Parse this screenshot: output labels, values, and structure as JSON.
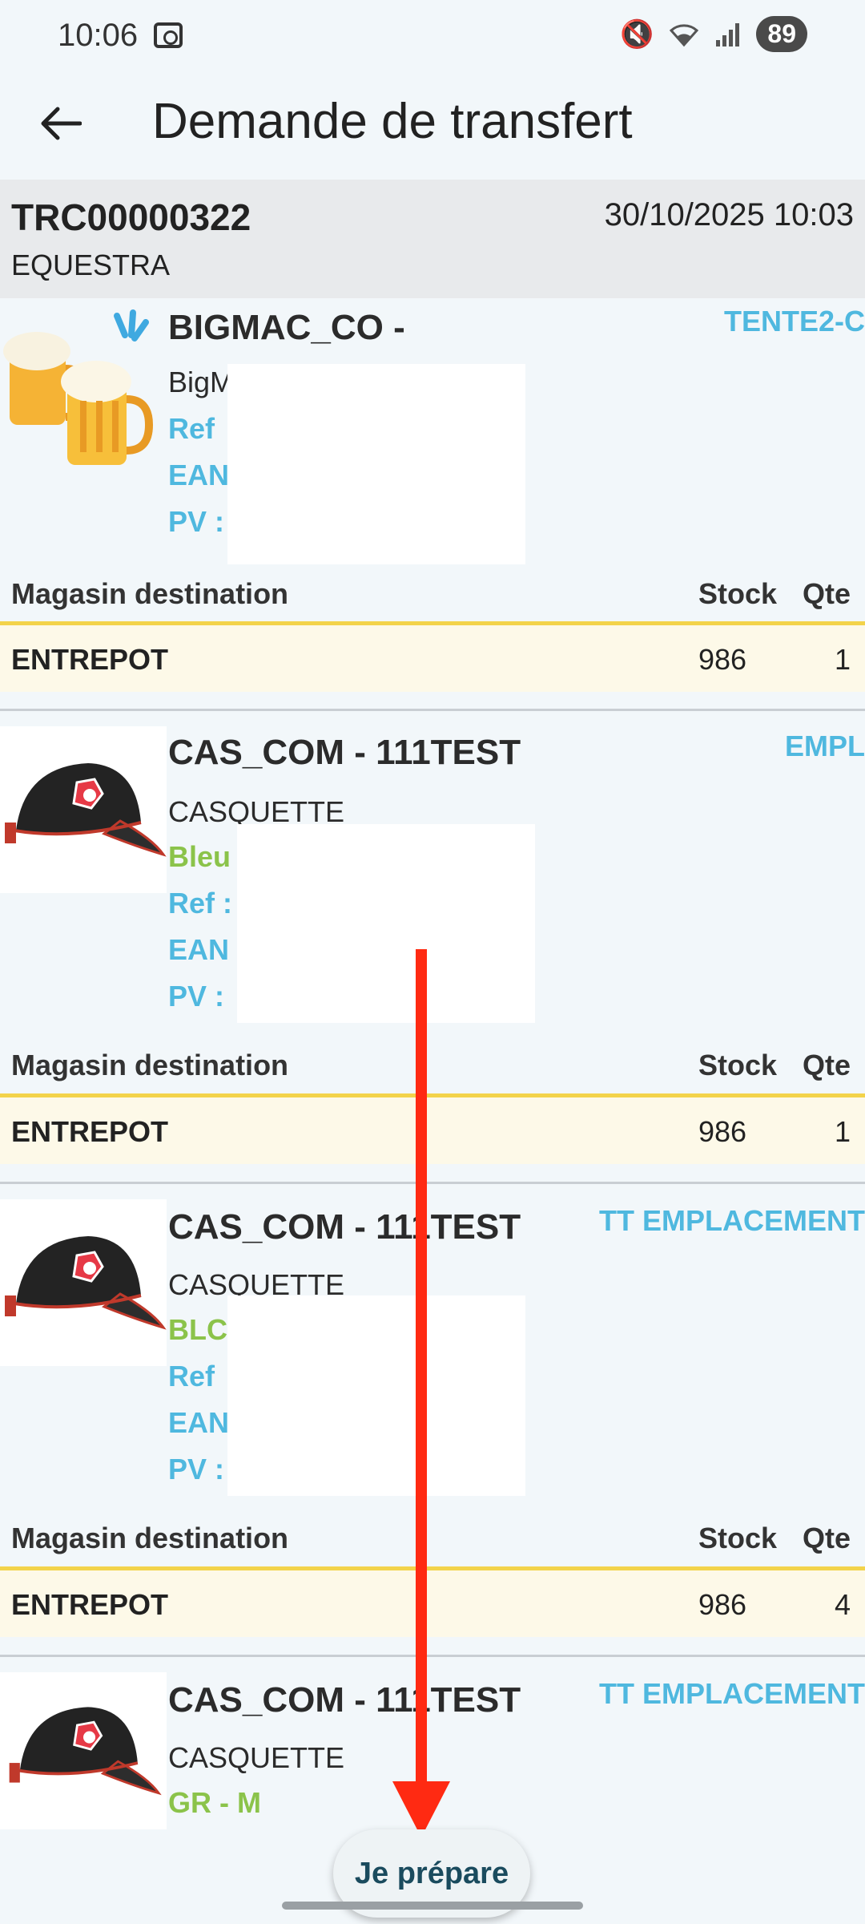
{
  "status_bar": {
    "time": "10:06",
    "battery": "89",
    "icons": [
      "screen-record-icon",
      "mute-icon",
      "wifi-icon",
      "signal-icon"
    ]
  },
  "app_bar": {
    "title": "Demande de transfert"
  },
  "order": {
    "id": "TRC00000322",
    "date": "30/10/2025 10:03",
    "client": "EQUESTRA"
  },
  "labels": {
    "destination_header": "Magasin destination",
    "stock_header": "Stock",
    "qty_header": "Qte"
  },
  "products": [
    {
      "title": "BIGMAC_CO -",
      "location": "TENTE2-C",
      "subtitle": "BigM",
      "variant": "",
      "ref": "Ref",
      "ean": "EAN",
      "pv": "PV :",
      "image": "beer-icon",
      "destination": "ENTREPOT",
      "stock": "986",
      "qty": "1"
    },
    {
      "title": "CAS_COM - 111TEST",
      "location": "EMPL",
      "subtitle": "CASQUETTE",
      "variant": "Bleu",
      "ref": "Ref :",
      "ean": "EAN",
      "pv": "PV :",
      "image": "cap-image",
      "destination": "ENTREPOT",
      "stock": "986",
      "qty": "1"
    },
    {
      "title": "CAS_COM - 111TEST",
      "location": "TT EMPLACEMENT",
      "subtitle": "CASQUETTE",
      "variant": "BLC",
      "ref": "Ref",
      "ean": "EAN",
      "pv": "PV :",
      "image": "cap-image",
      "destination": "ENTREPOT",
      "stock": "986",
      "qty": "4"
    },
    {
      "title": "CAS_COM - 111TEST",
      "location": "TT EMPLACEMENT",
      "subtitle": "CASQUETTE",
      "variant": "GR - M",
      "image": "cap-image"
    }
  ],
  "action_button": {
    "label": "Je prépare"
  },
  "colors": {
    "accent_blue": "#4fb8df",
    "variant_green": "#8bc34a",
    "highlight_yellow": "#f3d34a",
    "overlay_arrow": "#ff2a12"
  }
}
